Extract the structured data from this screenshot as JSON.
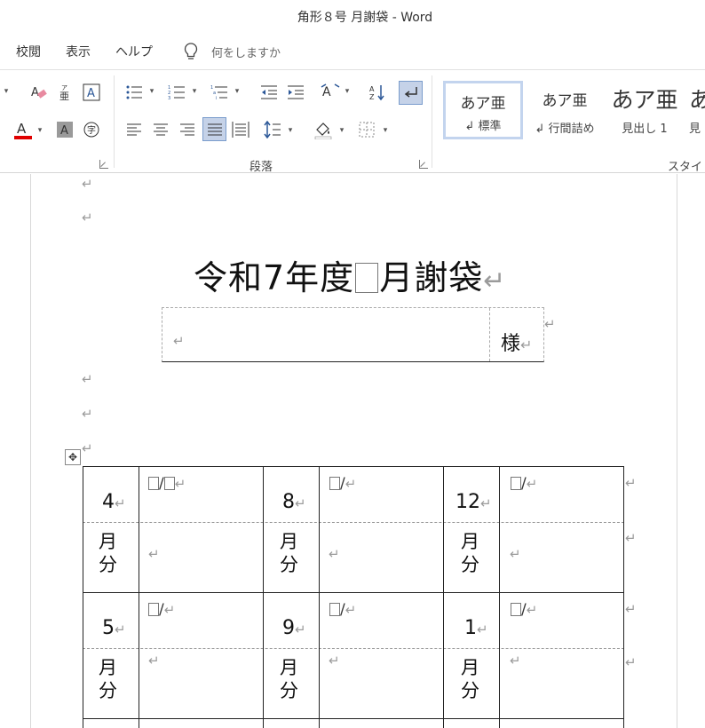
{
  "window": {
    "title": "角形８号 月謝袋 - Word"
  },
  "tabs": {
    "items": [
      "校閲",
      "表示",
      "ヘルプ"
    ],
    "tell_me_placeholder": "何をしますか"
  },
  "ribbon": {
    "paragraph_group_label": "段落",
    "styles_group_label": "スタイル",
    "font_color": "#e00000",
    "styles": [
      {
        "sample": "あア亜",
        "name": "↲ 標準"
      },
      {
        "sample": "あア亜",
        "name": "↲ 行間詰め"
      },
      {
        "sample": "あア亜",
        "name": "見出し 1"
      },
      {
        "sample": "あ",
        "name": "見"
      }
    ]
  },
  "document": {
    "title_pre": "令和7年度",
    "title_post": "月謝袋",
    "para_mark": "↵",
    "name_suffix": "様",
    "rows": [
      [
        {
          "month": "4",
          "date": "/"
        },
        {
          "month": "8",
          "date": "/"
        },
        {
          "month": "12",
          "date": "/"
        }
      ],
      [
        {
          "month": "5",
          "date": "/"
        },
        {
          "month": "9",
          "date": "/"
        },
        {
          "month": "1",
          "date": "/"
        }
      ]
    ],
    "month_unit_1": "月",
    "month_unit_2": "分"
  }
}
